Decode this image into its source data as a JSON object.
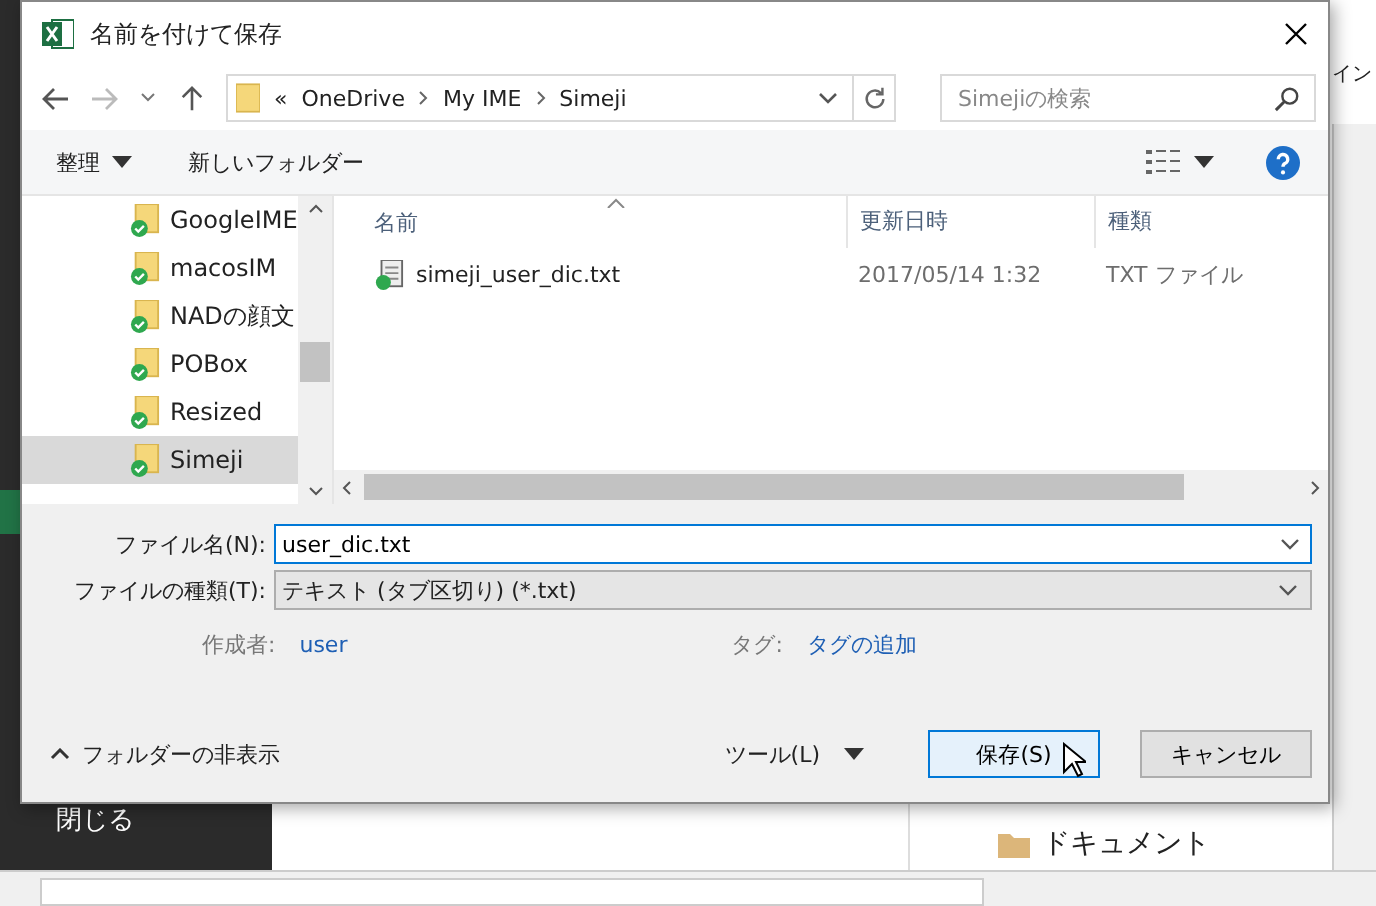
{
  "background": {
    "close_label": "閉じる",
    "ribbon_fragment": "イン",
    "folder_item": "ドキュメント"
  },
  "window": {
    "title": "名前を付けて保存"
  },
  "address_bar": {
    "overflow": "«",
    "path": [
      "OneDrive",
      "My IME",
      "Simeji"
    ]
  },
  "search": {
    "placeholder": "Simejiの検索"
  },
  "toolbar": {
    "organize": "整理",
    "new_folder": "新しいフォルダー"
  },
  "nav_tree": [
    {
      "label": "GoogleIME",
      "selected": false
    },
    {
      "label": "macosIM",
      "selected": false
    },
    {
      "label": "NADの顔文",
      "selected": false
    },
    {
      "label": "POBox",
      "selected": false
    },
    {
      "label": "Resized",
      "selected": false
    },
    {
      "label": "Simeji",
      "selected": true
    }
  ],
  "file_list": {
    "columns": [
      "名前",
      "更新日時",
      "種類"
    ],
    "rows": [
      {
        "name": "simeji_user_dic.txt",
        "modified": "2017/05/14 1:32",
        "type": "TXT ファイル"
      }
    ]
  },
  "form": {
    "file_name": {
      "label": "ファイル名(N):",
      "value": "user_dic.txt"
    },
    "file_type": {
      "label": "ファイルの種類(T):",
      "value": "テキスト (タブ区切り) (*.txt)"
    },
    "author": {
      "label": "作成者:",
      "value": "user"
    },
    "tags": {
      "label": "タグ:",
      "value": "タグの追加"
    }
  },
  "footer": {
    "hide_folders": "フォルダーの非表示",
    "tools": "ツール(L)",
    "save": "保存(S)",
    "cancel": "キャンセル"
  }
}
